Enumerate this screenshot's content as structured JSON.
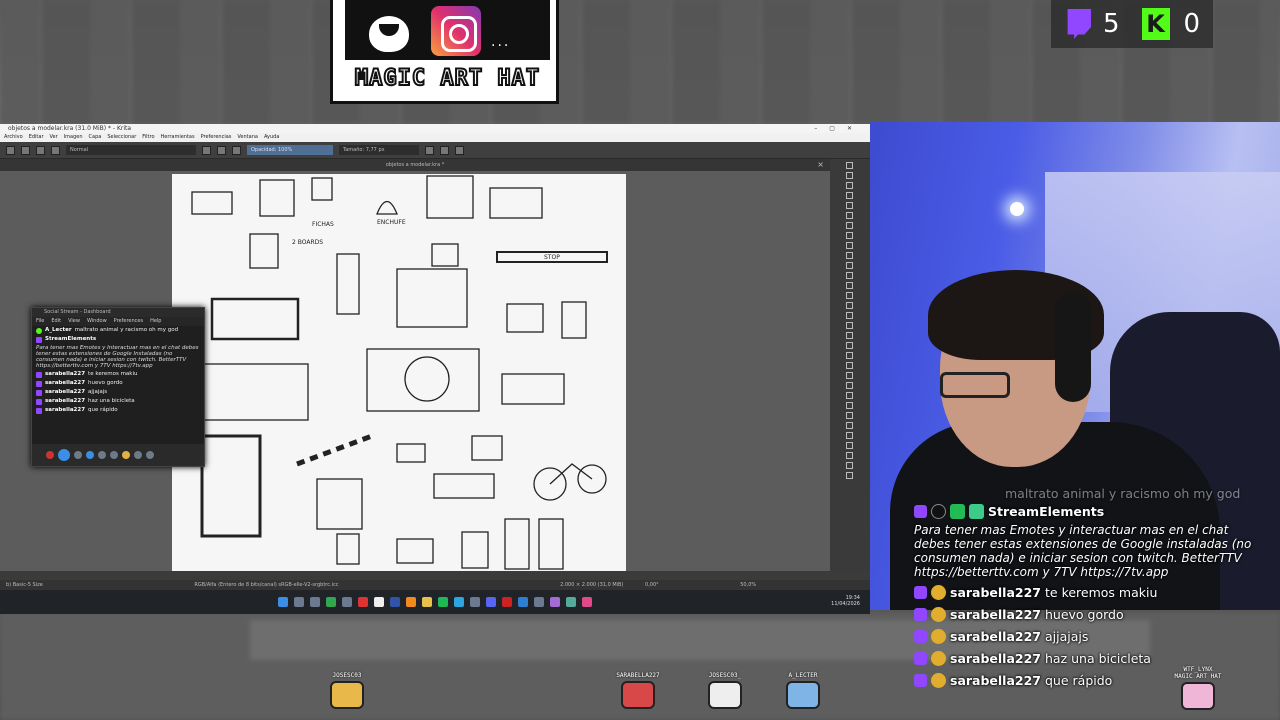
{
  "overlay": {
    "logo_text": "MAGIC ART HAT",
    "logo_dots": "...",
    "counters": [
      {
        "platform": "twitch",
        "value": "5",
        "color": "#9146ff"
      },
      {
        "platform": "kick",
        "value": "0",
        "color": "#53fc18"
      }
    ]
  },
  "krita": {
    "window_title": "objetos a modelar.kra (31.0 MiB) * - Krita",
    "menu": [
      "Archivo",
      "Editar",
      "Ver",
      "Imagen",
      "Capa",
      "Seleccionar",
      "Filtro",
      "Herramientas",
      "Preferencias",
      "Ventana",
      "Ayuda"
    ],
    "blend_mode": "Normal",
    "opacity": "Opacidad: 100%",
    "size": "Tamaño: 7,77 px",
    "doc_tab": "objetos a modelar.kra *",
    "sketch_labels": [
      "FICHAS",
      "ENCHUFE",
      "2 BOARDS",
      "STOP"
    ],
    "status_left": "b) Basic-5 Size",
    "status_mid": "RGB/Alfa (Entero de 8 bits/canal)  sRGB-elle-V2-srgbtrc.icc",
    "status_dims": "2.000 × 2.000 (31,0 MiB)",
    "status_rot": "0,00°",
    "status_zoom": "50,0%",
    "clock_time": "19:34",
    "clock_date": "11/04/2026"
  },
  "social_stream": {
    "title": "Social Stream - Dashboard",
    "menu": [
      "File",
      "Edit",
      "View",
      "Window",
      "Preferences",
      "Help"
    ],
    "messages": [
      {
        "user": "A_Lecter",
        "text": "maltrato animal y racismo oh my god",
        "badge": "kick"
      },
      {
        "user": "StreamElements",
        "text": "",
        "badge": "twitch"
      },
      {
        "system": "Para tener mas Emotes y Interactuar mas en el chat debes tener estas extensiones de Google Instaladas (no consumen nada) e iniciar sesion con twitch. BetterTTV https://betterttv.com y 7TV https://7tv.app"
      },
      {
        "user": "sarabella227",
        "text": "te keremos makiu",
        "badge": "twitch"
      },
      {
        "user": "sarabella227",
        "text": "huevo gordo",
        "badge": "twitch"
      },
      {
        "user": "sarabella227",
        "text": "ajjajajs",
        "badge": "twitch"
      },
      {
        "user": "sarabella227",
        "text": "haz una bicicleta",
        "badge": "twitch"
      },
      {
        "user": "sarabella227",
        "text": "que rápido",
        "badge": "twitch"
      }
    ]
  },
  "chat": {
    "faded_line": "maltrato animal y racismo oh my god",
    "bot_name": "StreamElements",
    "bot_message": "Para tener mas Emotes y interactuar mas en el chat debes tener estas extensiones de Google instaladas (no consumen nada) e iniciar sesion con twitch. BetterTTV https://betterttv.com y 7TV https://7tv.app",
    "lines": [
      {
        "user": "sarabella227",
        "text": "te keremos makiu"
      },
      {
        "user": "sarabella227",
        "text": "huevo gordo"
      },
      {
        "user": "sarabella227",
        "text": "ajjajajs"
      },
      {
        "user": "sarabella227",
        "text": "haz una bicicleta"
      },
      {
        "user": "sarabella227",
        "text": "que rápido"
      }
    ]
  },
  "avatars": [
    {
      "name": "JOSESC03"
    },
    {
      "name": "SARABELLA227"
    },
    {
      "name": "JOSESC03_"
    },
    {
      "name": "A_LECTER"
    },
    {
      "name": "WTF_LYNX"
    },
    {
      "name": "MAGIC ART HAT"
    }
  ]
}
